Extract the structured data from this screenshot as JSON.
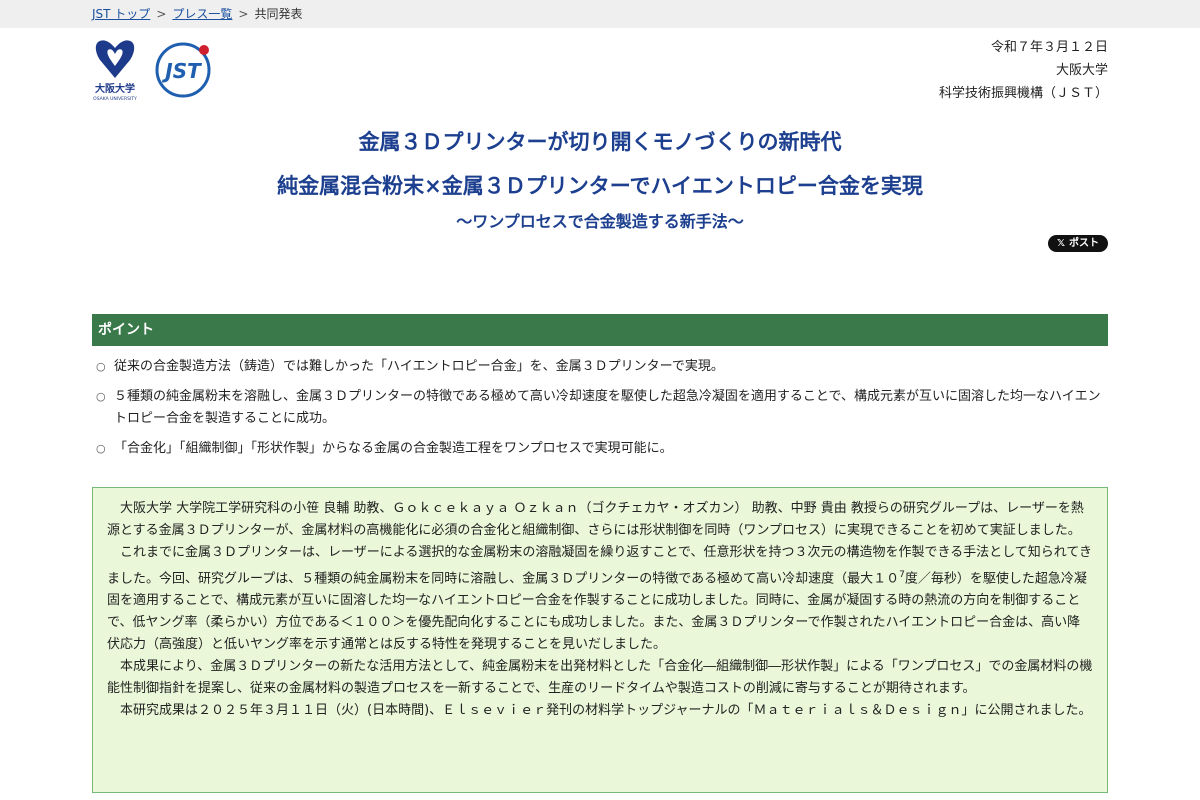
{
  "breadcrumb": {
    "home": "JST トップ",
    "press_list": "プレス一覧",
    "current": "共同発表",
    "separator": ">"
  },
  "logos": {
    "osaka_text": "大阪大学",
    "osaka_sub": "OSAKA UNIVERSITY",
    "jst_text": "JST"
  },
  "meta": {
    "date": "令和７年３月１２日",
    "org1": "大阪大学",
    "org2": "科学技術振興機構（ＪＳＴ）"
  },
  "title": {
    "line1": "金属３Ｄプリンターが切り開くモノづくりの新時代",
    "line2": "純金属混合粉末×金属３Ｄプリンターでハイエントロピー合金を実現",
    "subtitle": "～ワンプロセスで合金製造する新手法～"
  },
  "share": {
    "post_label": "ポスト",
    "x_glyph": "𝕏"
  },
  "points": {
    "heading": "ポイント",
    "bullet": "○",
    "items": [
      "従来の合金製造方法（鋳造）では難しかった「ハイエントロピー合金」を、金属３Ｄプリンターで実現。",
      "５種類の純金属粉末を溶融し、金属３Ｄプリンターの特徴である極めて高い冷却速度を駆使した超急冷凝固を適用することで、構成元素が互いに固溶した均一なハイエントロピー合金を製造することに成功。",
      "「合金化」「組織制御」「形状作製」からなる金属の合金製造工程をワンプロセスで実現可能に。"
    ]
  },
  "summary": {
    "p1": "大阪大学 大学院工学研究科の小笹 良輔 助教、Ｇｏｋｃｅｋａｙａ Ｏｚｋａｎ（ゴクチェカヤ・オズカン） 助教、中野 貴由 教授らの研究グループは、レーザーを熱源とする金属３Ｄプリンターが、金属材料の高機能化に必須の合金化と組織制御、さらには形状制御を同時（ワンプロセス）に実現できることを初めて実証しました。",
    "p2_before": "これまでに金属３Ｄプリンターは、レーザーによる選択的な金属粉末の溶融凝固を繰り返すことで、任意形状を持つ３次元の構造物を作製できる手法として知られてきました。今回、研究グループは、５種類の純金属粉末を同時に溶融し、金属３Ｄプリンターの特徴である極めて高い冷却速度（最大１０",
    "p2_sup": "7",
    "p2_after": "度／毎秒）を駆使した超急冷凝固を適用することで、構成元素が互いに固溶した均一なハイエントロピー合金を作製することに成功しました。同時に、金属が凝固する時の熱流の方向を制御することで、低ヤング率（柔らかい）方位である＜１００＞を優先配向化することにも成功しました。また、金属３Ｄプリンターで作製されたハイエントロピー合金は、高い降伏応力（高強度）と低いヤング率を示す通常とは反する特性を発現することを見いだしました。",
    "p3": "本成果により、金属３Ｄプリンターの新たな活用方法として、純金属粉末を出発材料とした「合金化―組織制御―形状作製」による「ワンプロセス」での金属材料の機能性制御指針を提案し、従来の金属材料の製造プロセスを一新することで、生産のリードタイムや製造コストの削減に寄与することが期待されます。",
    "p4": "本研究成果は２０２５年３月１１日（火）(日本時間)、Ｅｌｓｅｖｉｅｒ発刊の材料学トップジャーナルの「Ｍａｔｅｒｉａｌｓ＆Ｄｅｓｉｇｎ」に公開されました。"
  },
  "colors": {
    "title_blue": "#1d3f8f",
    "point_green": "#3a7a4a",
    "summary_bg": "#eaf7d8",
    "osaka_blue": "#1e3a8a",
    "jst_blue": "#1f5fb0"
  }
}
